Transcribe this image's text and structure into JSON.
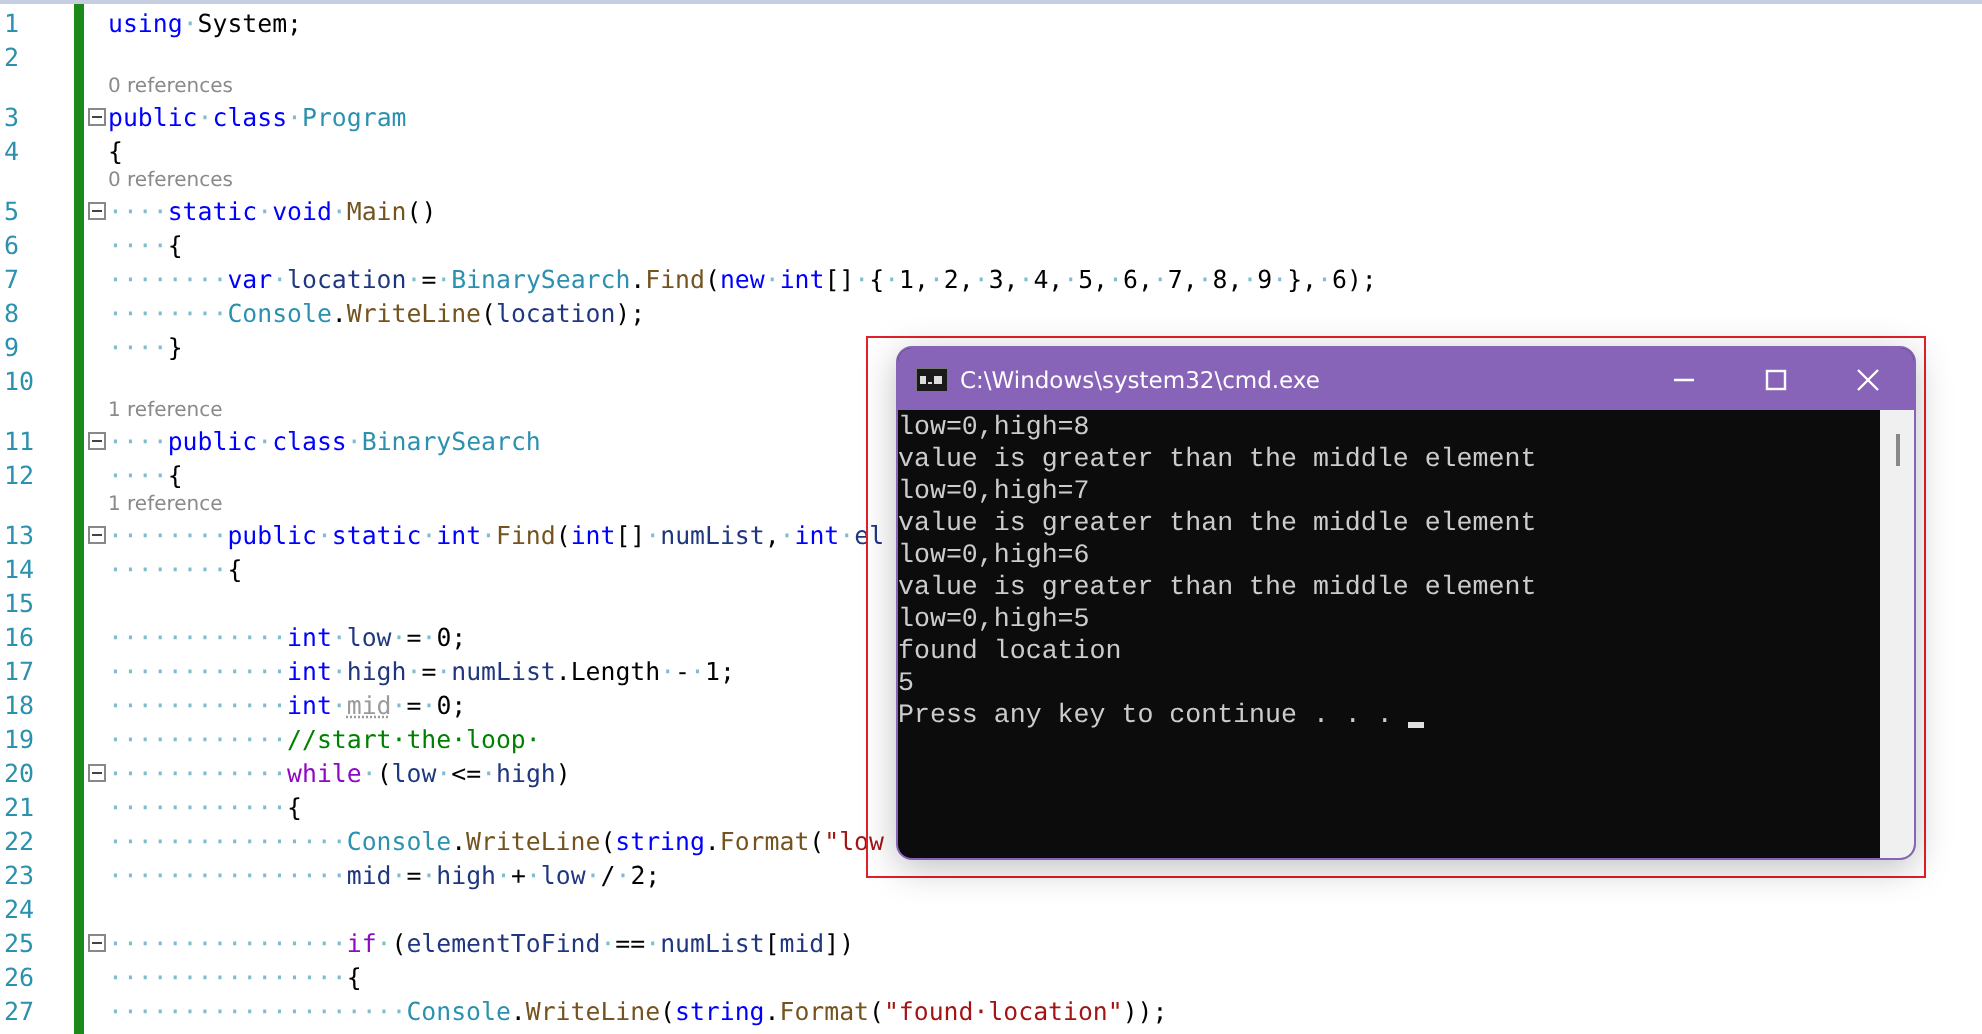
{
  "editor": {
    "lines": [
      {
        "number": "1",
        "foldable": false,
        "tokens": [
          {
            "kind": "kw",
            "text": "using"
          },
          {
            "kind": "ws",
            "text": "·"
          },
          {
            "kind": "pl",
            "text": "System;"
          }
        ]
      },
      {
        "number": "2",
        "foldable": false
      },
      {
        "lens": "0 references",
        "number": "3",
        "foldable": true,
        "tokens": [
          {
            "kind": "kw",
            "text": "public"
          },
          {
            "kind": "ws",
            "text": "·"
          },
          {
            "kind": "kw",
            "text": "class"
          },
          {
            "kind": "ws",
            "text": "·"
          },
          {
            "kind": "ty",
            "text": "Program"
          }
        ]
      },
      {
        "number": "4",
        "foldable": false,
        "tokens": [
          {
            "kind": "pl",
            "text": "{"
          }
        ]
      },
      {
        "lens": "0 references",
        "number": "5",
        "foldable": true,
        "tokens": [
          {
            "kind": "ws",
            "text": "····"
          },
          {
            "kind": "kw",
            "text": "static"
          },
          {
            "kind": "ws",
            "text": "·"
          },
          {
            "kind": "kw",
            "text": "void"
          },
          {
            "kind": "ws",
            "text": "·"
          },
          {
            "kind": "me",
            "text": "Main"
          },
          {
            "kind": "pl",
            "text": "()"
          }
        ]
      },
      {
        "number": "6",
        "foldable": false,
        "tokens": [
          {
            "kind": "ws",
            "text": "····"
          },
          {
            "kind": "pl",
            "text": "{"
          }
        ]
      },
      {
        "number": "7",
        "foldable": false,
        "tokens": [
          {
            "kind": "ws",
            "text": "········"
          },
          {
            "kind": "kw",
            "text": "var"
          },
          {
            "kind": "ws",
            "text": "·"
          },
          {
            "kind": "lv",
            "text": "location"
          },
          {
            "kind": "ws",
            "text": "·"
          },
          {
            "kind": "pl",
            "text": "="
          },
          {
            "kind": "ws",
            "text": "·"
          },
          {
            "kind": "ty",
            "text": "BinarySearch"
          },
          {
            "kind": "pl",
            "text": "."
          },
          {
            "kind": "me",
            "text": "Find"
          },
          {
            "kind": "pl",
            "text": "("
          },
          {
            "kind": "kw",
            "text": "new"
          },
          {
            "kind": "ws",
            "text": "·"
          },
          {
            "kind": "kw",
            "text": "int"
          },
          {
            "kind": "pl",
            "text": "[]"
          },
          {
            "kind": "ws",
            "text": "·"
          },
          {
            "kind": "pl",
            "text": "{"
          },
          {
            "kind": "ws",
            "text": "·"
          },
          {
            "kind": "pl",
            "text": "1,"
          },
          {
            "kind": "ws",
            "text": "·"
          },
          {
            "kind": "pl",
            "text": "2,"
          },
          {
            "kind": "ws",
            "text": "·"
          },
          {
            "kind": "pl",
            "text": "3,"
          },
          {
            "kind": "ws",
            "text": "·"
          },
          {
            "kind": "pl",
            "text": "4,"
          },
          {
            "kind": "ws",
            "text": "·"
          },
          {
            "kind": "pl",
            "text": "5,"
          },
          {
            "kind": "ws",
            "text": "·"
          },
          {
            "kind": "pl",
            "text": "6,"
          },
          {
            "kind": "ws",
            "text": "·"
          },
          {
            "kind": "pl",
            "text": "7,"
          },
          {
            "kind": "ws",
            "text": "·"
          },
          {
            "kind": "pl",
            "text": "8,"
          },
          {
            "kind": "ws",
            "text": "·"
          },
          {
            "kind": "pl",
            "text": "9"
          },
          {
            "kind": "ws",
            "text": "·"
          },
          {
            "kind": "pl",
            "text": "},"
          },
          {
            "kind": "ws",
            "text": "·"
          },
          {
            "kind": "pl",
            "text": "6);"
          }
        ]
      },
      {
        "number": "8",
        "foldable": false,
        "tokens": [
          {
            "kind": "ws",
            "text": "········"
          },
          {
            "kind": "ty",
            "text": "Console"
          },
          {
            "kind": "pl",
            "text": "."
          },
          {
            "kind": "me",
            "text": "WriteLine"
          },
          {
            "kind": "pl",
            "text": "("
          },
          {
            "kind": "lv",
            "text": "location"
          },
          {
            "kind": "pl",
            "text": ");"
          }
        ]
      },
      {
        "number": "9",
        "foldable": false,
        "tokens": [
          {
            "kind": "ws",
            "text": "····"
          },
          {
            "kind": "pl",
            "text": "}"
          }
        ]
      },
      {
        "number": "10",
        "foldable": false
      },
      {
        "lens": "1 reference",
        "number": "11",
        "foldable": true,
        "tokens": [
          {
            "kind": "ws",
            "text": "····"
          },
          {
            "kind": "kw",
            "text": "public"
          },
          {
            "kind": "ws",
            "text": "·"
          },
          {
            "kind": "kw",
            "text": "class"
          },
          {
            "kind": "ws",
            "text": "·"
          },
          {
            "kind": "ty",
            "text": "BinarySearch"
          }
        ]
      },
      {
        "number": "12",
        "foldable": false,
        "tokens": [
          {
            "kind": "ws",
            "text": "····"
          },
          {
            "kind": "pl",
            "text": "{"
          }
        ]
      },
      {
        "lens": "1 reference",
        "number": "13",
        "foldable": true,
        "tokens": [
          {
            "kind": "ws",
            "text": "········"
          },
          {
            "kind": "kw",
            "text": "public"
          },
          {
            "kind": "ws",
            "text": "·"
          },
          {
            "kind": "kw",
            "text": "static"
          },
          {
            "kind": "ws",
            "text": "·"
          },
          {
            "kind": "kw",
            "text": "int"
          },
          {
            "kind": "ws",
            "text": "·"
          },
          {
            "kind": "me",
            "text": "Find"
          },
          {
            "kind": "pl",
            "text": "("
          },
          {
            "kind": "kw",
            "text": "int"
          },
          {
            "kind": "pl",
            "text": "[]"
          },
          {
            "kind": "ws",
            "text": "·"
          },
          {
            "kind": "lv",
            "text": "numList"
          },
          {
            "kind": "pl",
            "text": ","
          },
          {
            "kind": "ws",
            "text": "·"
          },
          {
            "kind": "kw",
            "text": "int"
          },
          {
            "kind": "ws",
            "text": "·"
          },
          {
            "kind": "lv",
            "text": "el"
          }
        ]
      },
      {
        "number": "14",
        "foldable": false,
        "tokens": [
          {
            "kind": "ws",
            "text": "········"
          },
          {
            "kind": "pl",
            "text": "{"
          }
        ]
      },
      {
        "number": "15",
        "foldable": false
      },
      {
        "number": "16",
        "foldable": false,
        "tokens": [
          {
            "kind": "ws",
            "text": "············"
          },
          {
            "kind": "kw",
            "text": "int"
          },
          {
            "kind": "ws",
            "text": "·"
          },
          {
            "kind": "lv",
            "text": "low"
          },
          {
            "kind": "ws",
            "text": "·"
          },
          {
            "kind": "pl",
            "text": "="
          },
          {
            "kind": "ws",
            "text": "·"
          },
          {
            "kind": "pl",
            "text": "0;"
          }
        ]
      },
      {
        "number": "17",
        "foldable": false,
        "tokens": [
          {
            "kind": "ws",
            "text": "············"
          },
          {
            "kind": "kw",
            "text": "int"
          },
          {
            "kind": "ws",
            "text": "·"
          },
          {
            "kind": "lv",
            "text": "high"
          },
          {
            "kind": "ws",
            "text": "·"
          },
          {
            "kind": "pl",
            "text": "="
          },
          {
            "kind": "ws",
            "text": "·"
          },
          {
            "kind": "lv",
            "text": "numList"
          },
          {
            "kind": "pl",
            "text": ".Length"
          },
          {
            "kind": "ws",
            "text": "·"
          },
          {
            "kind": "pl",
            "text": "-"
          },
          {
            "kind": "ws",
            "text": "·"
          },
          {
            "kind": "pl",
            "text": "1;"
          }
        ]
      },
      {
        "number": "18",
        "foldable": false,
        "tokens": [
          {
            "kind": "ws",
            "text": "············"
          },
          {
            "kind": "kw",
            "text": "int"
          },
          {
            "kind": "ws",
            "text": "·"
          },
          {
            "kind": "un",
            "text": "mid"
          },
          {
            "kind": "ws",
            "text": "·"
          },
          {
            "kind": "pl",
            "text": "="
          },
          {
            "kind": "ws",
            "text": "·"
          },
          {
            "kind": "pl",
            "text": "0;"
          }
        ]
      },
      {
        "number": "19",
        "foldable": false,
        "tokens": [
          {
            "kind": "ws",
            "text": "············"
          },
          {
            "kind": "cm",
            "text": "//start·the·loop·"
          }
        ]
      },
      {
        "number": "20",
        "foldable": true,
        "tokens": [
          {
            "kind": "ws",
            "text": "············"
          },
          {
            "kind": "ct",
            "text": "while"
          },
          {
            "kind": "ws",
            "text": "·"
          },
          {
            "kind": "pl",
            "text": "("
          },
          {
            "kind": "lv",
            "text": "low"
          },
          {
            "kind": "ws",
            "text": "·"
          },
          {
            "kind": "pl",
            "text": "<="
          },
          {
            "kind": "ws",
            "text": "·"
          },
          {
            "kind": "lv",
            "text": "high"
          },
          {
            "kind": "pl",
            "text": ")"
          }
        ]
      },
      {
        "number": "21",
        "foldable": false,
        "tokens": [
          {
            "kind": "ws",
            "text": "············"
          },
          {
            "kind": "pl",
            "text": "{"
          }
        ]
      },
      {
        "number": "22",
        "foldable": false,
        "tokens": [
          {
            "kind": "ws",
            "text": "················"
          },
          {
            "kind": "ty",
            "text": "Console"
          },
          {
            "kind": "pl",
            "text": "."
          },
          {
            "kind": "me",
            "text": "WriteLine"
          },
          {
            "kind": "pl",
            "text": "("
          },
          {
            "kind": "kw",
            "text": "string"
          },
          {
            "kind": "pl",
            "text": "."
          },
          {
            "kind": "me",
            "text": "Format"
          },
          {
            "kind": "pl",
            "text": "("
          },
          {
            "kind": "st",
            "text": "\"low"
          }
        ]
      },
      {
        "number": "23",
        "foldable": false,
        "tokens": [
          {
            "kind": "ws",
            "text": "················"
          },
          {
            "kind": "lv",
            "text": "mid"
          },
          {
            "kind": "ws",
            "text": "·"
          },
          {
            "kind": "pl",
            "text": "="
          },
          {
            "kind": "ws",
            "text": "·"
          },
          {
            "kind": "lv",
            "text": "high"
          },
          {
            "kind": "ws",
            "text": "·"
          },
          {
            "kind": "pl",
            "text": "+"
          },
          {
            "kind": "ws",
            "text": "·"
          },
          {
            "kind": "lv",
            "text": "low"
          },
          {
            "kind": "ws",
            "text": "·"
          },
          {
            "kind": "pl",
            "text": "/"
          },
          {
            "kind": "ws",
            "text": "·"
          },
          {
            "kind": "pl",
            "text": "2;"
          }
        ]
      },
      {
        "number": "24",
        "foldable": false
      },
      {
        "number": "25",
        "foldable": true,
        "tokens": [
          {
            "kind": "ws",
            "text": "················"
          },
          {
            "kind": "ct",
            "text": "if"
          },
          {
            "kind": "ws",
            "text": "·"
          },
          {
            "kind": "pl",
            "text": "("
          },
          {
            "kind": "lv",
            "text": "elementToFind"
          },
          {
            "kind": "ws",
            "text": "·"
          },
          {
            "kind": "pl",
            "text": "=="
          },
          {
            "kind": "ws",
            "text": "·"
          },
          {
            "kind": "lv",
            "text": "numList"
          },
          {
            "kind": "pl",
            "text": "["
          },
          {
            "kind": "lv",
            "text": "mid"
          },
          {
            "kind": "pl",
            "text": "])"
          }
        ]
      },
      {
        "number": "26",
        "foldable": false,
        "tokens": [
          {
            "kind": "ws",
            "text": "················"
          },
          {
            "kind": "pl",
            "text": "{"
          }
        ]
      },
      {
        "number": "27",
        "foldable": false,
        "tokens": [
          {
            "kind": "ws",
            "text": "····················"
          },
          {
            "kind": "ty",
            "text": "Console"
          },
          {
            "kind": "pl",
            "text": "."
          },
          {
            "kind": "me",
            "text": "WriteLine"
          },
          {
            "kind": "pl",
            "text": "("
          },
          {
            "kind": "kw",
            "text": "string"
          },
          {
            "kind": "pl",
            "text": "."
          },
          {
            "kind": "me",
            "text": "Format"
          },
          {
            "kind": "pl",
            "text": "("
          },
          {
            "kind": "st",
            "text": "\"found·location\""
          },
          {
            "kind": "pl",
            "text": "));"
          }
        ]
      }
    ]
  },
  "console_window": {
    "title": "C:\\Windows\\system32\\cmd.exe",
    "highlighted": true,
    "cursor": true,
    "output": [
      "low=0,high=8",
      "value is greater than the middle element",
      "low=0,high=7",
      "value is greater than the middle element",
      "low=0,high=6",
      "value is greater than the middle element",
      "low=0,high=5",
      "found location",
      "5",
      "Press any key to continue . . . "
    ]
  }
}
